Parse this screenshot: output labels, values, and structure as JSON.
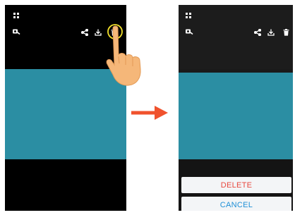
{
  "colors": {
    "photo": "#2b8ea3",
    "arrow": "#f0522d",
    "tap_ring": "#f2e02b",
    "delete_text": "#e8493f",
    "cancel_text": "#1f8fd6",
    "icon": "#ffffff"
  },
  "icons": [
    "grid-menu-icon",
    "camera-search-icon",
    "share-icon",
    "download-icon",
    "trash-icon",
    "pointing-hand-icon",
    "arrow-right-icon"
  ],
  "dialog": {
    "delete_label": "DELETE",
    "cancel_label": "CANCEL"
  }
}
